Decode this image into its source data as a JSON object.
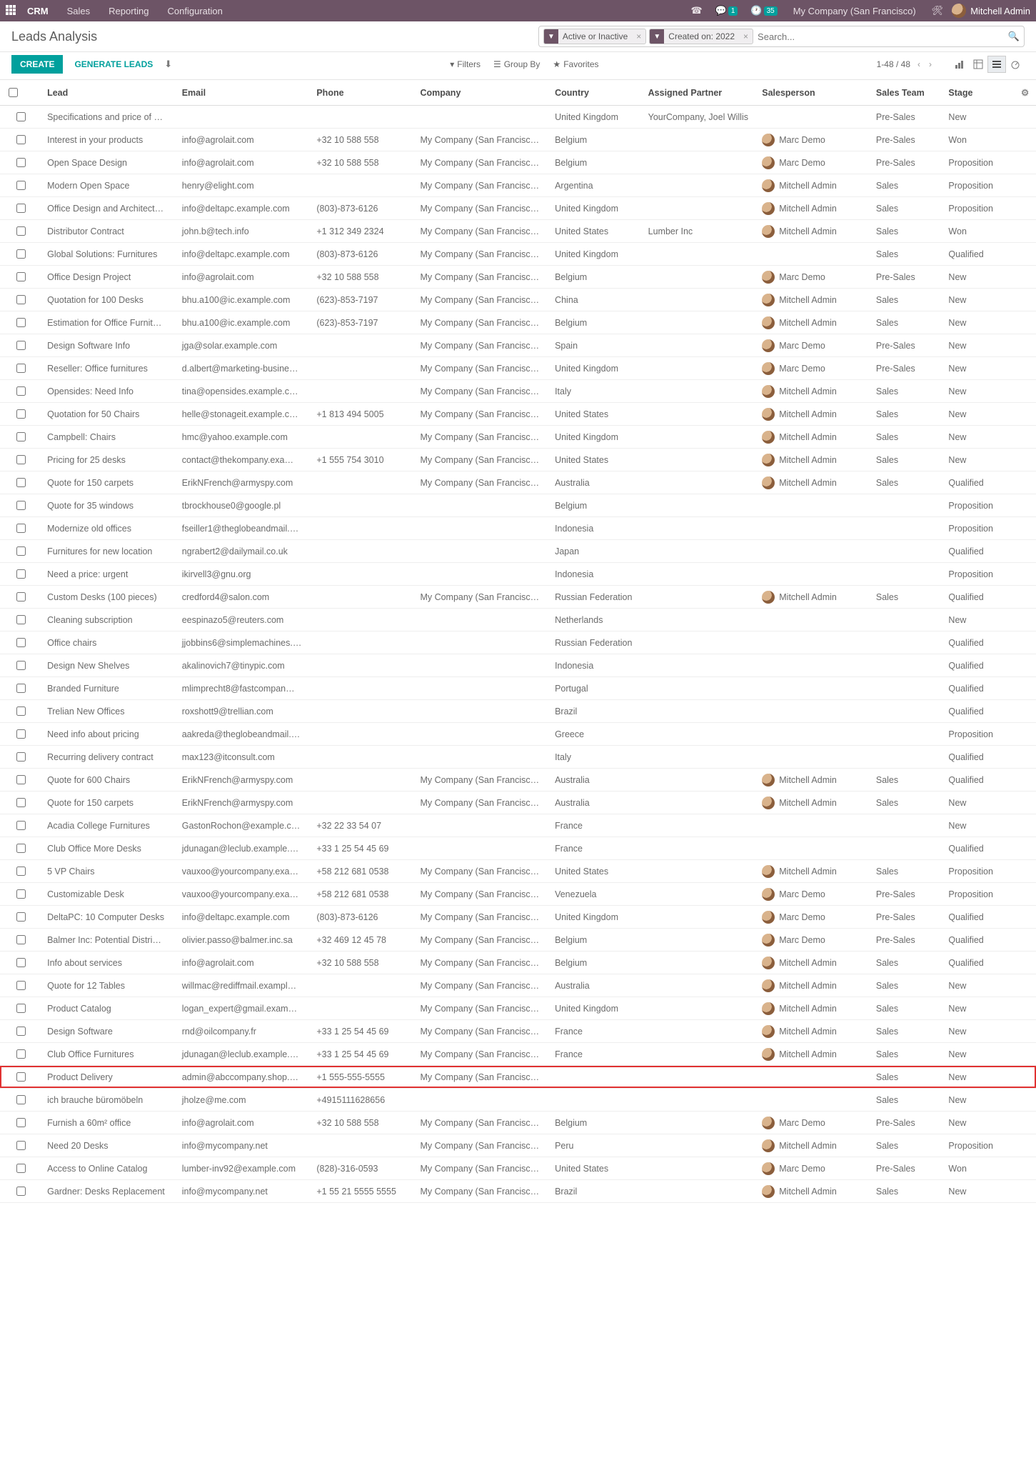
{
  "topnav": {
    "brand": "CRM",
    "menu": [
      "Sales",
      "Reporting",
      "Configuration"
    ],
    "msg_badge": "1",
    "clock_badge": "35",
    "company": "My Company (San Francisco)",
    "user": "Mitchell Admin"
  },
  "breadcrumb": "Leads Analysis",
  "search": {
    "facet1": "Active or Inactive",
    "facet2": "Created on: 2022",
    "placeholder": "Search..."
  },
  "actions": {
    "create": "CREATE",
    "generate": "GENERATE LEADS"
  },
  "filters": {
    "filters": "Filters",
    "groupby": "Group By",
    "favorites": "Favorites"
  },
  "pager": {
    "range": "1-48 / 48"
  },
  "columns": {
    "lead": "Lead",
    "email": "Email",
    "phone": "Phone",
    "company": "Company",
    "country": "Country",
    "partner": "Assigned Partner",
    "salesperson": "Salesperson",
    "team": "Sales Team",
    "stage": "Stage"
  },
  "rows": [
    {
      "lead": "Specifications and price of …",
      "email": "",
      "phone": "",
      "company": "",
      "country": "United Kingdom",
      "partner": "YourCompany, Joel Willis",
      "sp": "",
      "team": "Pre-Sales",
      "stage": "New"
    },
    {
      "lead": "Interest in your products",
      "email": "info@agrolait.com",
      "phone": "+32 10 588 558",
      "company": "My Company (San Francisc…",
      "country": "Belgium",
      "partner": "",
      "sp": "Marc Demo",
      "team": "Pre-Sales",
      "stage": "Won"
    },
    {
      "lead": "Open Space Design",
      "email": "info@agrolait.com",
      "phone": "+32 10 588 558",
      "company": "My Company (San Francisc…",
      "country": "Belgium",
      "partner": "",
      "sp": "Marc Demo",
      "team": "Pre-Sales",
      "stage": "Proposition"
    },
    {
      "lead": "Modern Open Space",
      "email": "henry@elight.com",
      "phone": "",
      "company": "My Company (San Francisc…",
      "country": "Argentina",
      "partner": "",
      "sp": "Mitchell Admin",
      "team": "Sales",
      "stage": "Proposition"
    },
    {
      "lead": "Office Design and Architect…",
      "email": "info@deltapc.example.com",
      "phone": "(803)-873-6126",
      "company": "My Company (San Francisc…",
      "country": "United Kingdom",
      "partner": "",
      "sp": "Mitchell Admin",
      "team": "Sales",
      "stage": "Proposition"
    },
    {
      "lead": "Distributor Contract",
      "email": "john.b@tech.info",
      "phone": "+1 312 349 2324",
      "company": "My Company (San Francisc…",
      "country": "United States",
      "partner": "Lumber Inc",
      "sp": "Mitchell Admin",
      "team": "Sales",
      "stage": "Won"
    },
    {
      "lead": "Global Solutions: Furnitures",
      "email": "info@deltapc.example.com",
      "phone": "(803)-873-6126",
      "company": "My Company (San Francisc…",
      "country": "United Kingdom",
      "partner": "",
      "sp": "",
      "team": "Sales",
      "stage": "Qualified"
    },
    {
      "lead": "Office Design Project",
      "email": "info@agrolait.com",
      "phone": "+32 10 588 558",
      "company": "My Company (San Francisc…",
      "country": "Belgium",
      "partner": "",
      "sp": "Marc Demo",
      "team": "Pre-Sales",
      "stage": "New"
    },
    {
      "lead": "Quotation for 100 Desks",
      "email": "bhu.a100@ic.example.com",
      "phone": "(623)-853-7197",
      "company": "My Company (San Francisc…",
      "country": "China",
      "partner": "",
      "sp": "Mitchell Admin",
      "team": "Sales",
      "stage": "New"
    },
    {
      "lead": "Estimation for Office Furnit…",
      "email": "bhu.a100@ic.example.com",
      "phone": "(623)-853-7197",
      "company": "My Company (San Francisc…",
      "country": "Belgium",
      "partner": "",
      "sp": "Mitchell Admin",
      "team": "Sales",
      "stage": "New"
    },
    {
      "lead": "Design Software Info",
      "email": "jga@solar.example.com",
      "phone": "",
      "company": "My Company (San Francisc…",
      "country": "Spain",
      "partner": "",
      "sp": "Marc Demo",
      "team": "Pre-Sales",
      "stage": "New"
    },
    {
      "lead": "Reseller: Office furnitures",
      "email": "d.albert@marketing-busine…",
      "phone": "",
      "company": "My Company (San Francisc…",
      "country": "United Kingdom",
      "partner": "",
      "sp": "Marc Demo",
      "team": "Pre-Sales",
      "stage": "New"
    },
    {
      "lead": "Opensides: Need Info",
      "email": "tina@opensides.example.c…",
      "phone": "",
      "company": "My Company (San Francisc…",
      "country": "Italy",
      "partner": "",
      "sp": "Mitchell Admin",
      "team": "Sales",
      "stage": "New"
    },
    {
      "lead": "Quotation for 50 Chairs",
      "email": "helle@stonageit.example.c…",
      "phone": "+1 813 494 5005",
      "company": "My Company (San Francisc…",
      "country": "United States",
      "partner": "",
      "sp": "Mitchell Admin",
      "team": "Sales",
      "stage": "New"
    },
    {
      "lead": "Campbell: Chairs",
      "email": "hmc@yahoo.example.com",
      "phone": "",
      "company": "My Company (San Francisc…",
      "country": "United Kingdom",
      "partner": "",
      "sp": "Mitchell Admin",
      "team": "Sales",
      "stage": "New"
    },
    {
      "lead": "Pricing for 25 desks",
      "email": "contact@thekompany.exa…",
      "phone": "+1 555 754 3010",
      "company": "My Company (San Francisc…",
      "country": "United States",
      "partner": "",
      "sp": "Mitchell Admin",
      "team": "Sales",
      "stage": "New"
    },
    {
      "lead": "Quote for 150 carpets",
      "email": "ErikNFrench@armyspy.com",
      "phone": "",
      "company": "My Company (San Francisc…",
      "country": "Australia",
      "partner": "",
      "sp": "Mitchell Admin",
      "team": "Sales",
      "stage": "Qualified"
    },
    {
      "lead": "Quote for 35 windows",
      "email": "tbrockhouse0@google.pl",
      "phone": "",
      "company": "",
      "country": "Belgium",
      "partner": "",
      "sp": "",
      "team": "",
      "stage": "Proposition"
    },
    {
      "lead": "Modernize old offices",
      "email": "fseiller1@theglobeandmail.…",
      "phone": "",
      "company": "",
      "country": "Indonesia",
      "partner": "",
      "sp": "",
      "team": "",
      "stage": "Proposition"
    },
    {
      "lead": "Furnitures for new location",
      "email": "ngrabert2@dailymail.co.uk",
      "phone": "",
      "company": "",
      "country": "Japan",
      "partner": "",
      "sp": "",
      "team": "",
      "stage": "Qualified"
    },
    {
      "lead": "Need a price: urgent",
      "email": "ikirvell3@gnu.org",
      "phone": "",
      "company": "",
      "country": "Indonesia",
      "partner": "",
      "sp": "",
      "team": "",
      "stage": "Proposition"
    },
    {
      "lead": "Custom Desks (100 pieces)",
      "email": "credford4@salon.com",
      "phone": "",
      "company": "My Company (San Francisc…",
      "country": "Russian Federation",
      "partner": "",
      "sp": "Mitchell Admin",
      "team": "Sales",
      "stage": "Qualified"
    },
    {
      "lead": "Cleaning subscription",
      "email": "eespinazo5@reuters.com",
      "phone": "",
      "company": "",
      "country": "Netherlands",
      "partner": "",
      "sp": "",
      "team": "",
      "stage": "New"
    },
    {
      "lead": "Office chairs",
      "email": "jjobbins6@simplemachines.…",
      "phone": "",
      "company": "",
      "country": "Russian Federation",
      "partner": "",
      "sp": "",
      "team": "",
      "stage": "Qualified"
    },
    {
      "lead": "Design New Shelves",
      "email": "akalinovich7@tinypic.com",
      "phone": "",
      "company": "",
      "country": "Indonesia",
      "partner": "",
      "sp": "",
      "team": "",
      "stage": "Qualified"
    },
    {
      "lead": "Branded Furniture",
      "email": "mlimprecht8@fastcompan…",
      "phone": "",
      "company": "",
      "country": "Portugal",
      "partner": "",
      "sp": "",
      "team": "",
      "stage": "Qualified"
    },
    {
      "lead": "Trelian New Offices",
      "email": "roxshott9@trellian.com",
      "phone": "",
      "company": "",
      "country": "Brazil",
      "partner": "",
      "sp": "",
      "team": "",
      "stage": "Qualified"
    },
    {
      "lead": "Need info about pricing",
      "email": "aakreda@theglobeandmail.…",
      "phone": "",
      "company": "",
      "country": "Greece",
      "partner": "",
      "sp": "",
      "team": "",
      "stage": "Proposition"
    },
    {
      "lead": "Recurring delivery contract",
      "email": "max123@itconsult.com",
      "phone": "",
      "company": "",
      "country": "Italy",
      "partner": "",
      "sp": "",
      "team": "",
      "stage": "Qualified"
    },
    {
      "lead": "Quote for 600 Chairs",
      "email": "ErikNFrench@armyspy.com",
      "phone": "",
      "company": "My Company (San Francisc…",
      "country": "Australia",
      "partner": "",
      "sp": "Mitchell Admin",
      "team": "Sales",
      "stage": "Qualified"
    },
    {
      "lead": "Quote for 150 carpets",
      "email": "ErikNFrench@armyspy.com",
      "phone": "",
      "company": "My Company (San Francisc…",
      "country": "Australia",
      "partner": "",
      "sp": "Mitchell Admin",
      "team": "Sales",
      "stage": "New"
    },
    {
      "lead": "Acadia College Furnitures",
      "email": "GastonRochon@example.c…",
      "phone": "+32 22 33 54 07",
      "company": "",
      "country": "France",
      "partner": "",
      "sp": "",
      "team": "",
      "stage": "New"
    },
    {
      "lead": "Club Office More Desks",
      "email": "jdunagan@leclub.example.…",
      "phone": "+33 1 25 54 45 69",
      "company": "",
      "country": "France",
      "partner": "",
      "sp": "",
      "team": "",
      "stage": "Qualified"
    },
    {
      "lead": "5 VP Chairs",
      "email": "vauxoo@yourcompany.exa…",
      "phone": "+58 212 681 0538",
      "company": "My Company (San Francisc…",
      "country": "United States",
      "partner": "",
      "sp": "Mitchell Admin",
      "team": "Sales",
      "stage": "Proposition"
    },
    {
      "lead": "Customizable Desk",
      "email": "vauxoo@yourcompany.exa…",
      "phone": "+58 212 681 0538",
      "company": "My Company (San Francisc…",
      "country": "Venezuela",
      "partner": "",
      "sp": "Marc Demo",
      "team": "Pre-Sales",
      "stage": "Proposition"
    },
    {
      "lead": "DeltaPC: 10 Computer Desks",
      "email": "info@deltapc.example.com",
      "phone": "(803)-873-6126",
      "company": "My Company (San Francisc…",
      "country": "United Kingdom",
      "partner": "",
      "sp": "Marc Demo",
      "team": "Pre-Sales",
      "stage": "Qualified"
    },
    {
      "lead": "Balmer Inc: Potential Distri…",
      "email": "olivier.passo@balmer.inc.sa",
      "phone": "+32 469 12 45 78",
      "company": "My Company (San Francisc…",
      "country": "Belgium",
      "partner": "",
      "sp": "Marc Demo",
      "team": "Pre-Sales",
      "stage": "Qualified"
    },
    {
      "lead": "Info about services",
      "email": "info@agrolait.com",
      "phone": "+32 10 588 558",
      "company": "My Company (San Francisc…",
      "country": "Belgium",
      "partner": "",
      "sp": "Mitchell Admin",
      "team": "Sales",
      "stage": "Qualified"
    },
    {
      "lead": "Quote for 12 Tables",
      "email": "willmac@rediffmail.exampl…",
      "phone": "",
      "company": "My Company (San Francisc…",
      "country": "Australia",
      "partner": "",
      "sp": "Mitchell Admin",
      "team": "Sales",
      "stage": "New"
    },
    {
      "lead": "Product Catalog",
      "email": "logan_expert@gmail.exam…",
      "phone": "",
      "company": "My Company (San Francisc…",
      "country": "United Kingdom",
      "partner": "",
      "sp": "Mitchell Admin",
      "team": "Sales",
      "stage": "New"
    },
    {
      "lead": "Design Software",
      "email": "rnd@oilcompany.fr",
      "phone": "+33 1 25 54 45 69",
      "company": "My Company (San Francisc…",
      "country": "France",
      "partner": "",
      "sp": "Mitchell Admin",
      "team": "Sales",
      "stage": "New"
    },
    {
      "lead": "Club Office Furnitures",
      "email": "jdunagan@leclub.example.…",
      "phone": "+33 1 25 54 45 69",
      "company": "My Company (San Francisc…",
      "country": "France",
      "partner": "",
      "sp": "Mitchell Admin",
      "team": "Sales",
      "stage": "New"
    },
    {
      "lead": "Product Delivery",
      "email": "admin@abccompany.shop.…",
      "phone": "+1 555-555-5555",
      "company": "My Company (San Francisc…",
      "country": "",
      "partner": "",
      "sp": "",
      "team": "Sales",
      "stage": "New",
      "highlight": true
    },
    {
      "lead": "ich brauche büromöbeln",
      "email": "jholze@me.com",
      "phone": "+4915111628656",
      "company": "",
      "country": "",
      "partner": "",
      "sp": "",
      "team": "Sales",
      "stage": "New"
    },
    {
      "lead": "Furnish a 60m² office",
      "email": "info@agrolait.com",
      "phone": "+32 10 588 558",
      "company": "My Company (San Francisc…",
      "country": "Belgium",
      "partner": "",
      "sp": "Marc Demo",
      "team": "Pre-Sales",
      "stage": "New"
    },
    {
      "lead": "Need 20 Desks",
      "email": "info@mycompany.net",
      "phone": "",
      "company": "My Company (San Francisc…",
      "country": "Peru",
      "partner": "",
      "sp": "Mitchell Admin",
      "team": "Sales",
      "stage": "Proposition"
    },
    {
      "lead": "Access to Online Catalog",
      "email": "lumber-inv92@example.com",
      "phone": "(828)-316-0593",
      "company": "My Company (San Francisc…",
      "country": "United States",
      "partner": "",
      "sp": "Marc Demo",
      "team": "Pre-Sales",
      "stage": "Won"
    },
    {
      "lead": "Gardner: Desks Replacement",
      "email": "info@mycompany.net",
      "phone": "+1 55 21 5555 5555",
      "company": "My Company (San Francisc…",
      "country": "Brazil",
      "partner": "",
      "sp": "Mitchell Admin",
      "team": "Sales",
      "stage": "New"
    }
  ]
}
